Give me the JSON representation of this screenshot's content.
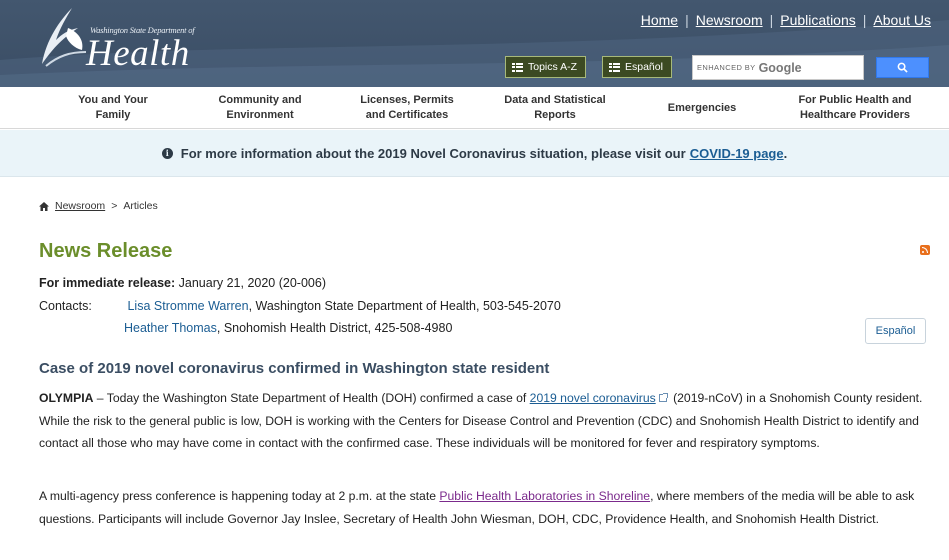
{
  "logo": {
    "department": "Washington State Department of",
    "word": "Health"
  },
  "toplinks": [
    "Home",
    "Newsroom",
    "Publications",
    "About Us"
  ],
  "buttons": {
    "topics": "Topics A-Z",
    "espanol": "Español"
  },
  "search": {
    "enhanced_by": "ENHANCED BY",
    "google": "Google"
  },
  "nav": [
    {
      "line1": "You and Your",
      "line2": "Family"
    },
    {
      "line1": "Community and",
      "line2": "Environment"
    },
    {
      "line1": "Licenses, Permits",
      "line2": "and Certificates"
    },
    {
      "line1": "Data and Statistical",
      "line2": "Reports"
    },
    {
      "line1": "Emergencies",
      "line2": ""
    },
    {
      "line1": "For Public Health and",
      "line2": "Healthcare Providers"
    }
  ],
  "alert": {
    "text": "For more information about the 2019 Novel Coronavirus situation, please visit our",
    "link": "COVID-19 page",
    "end": "."
  },
  "breadcrumb": {
    "link": "Newsroom",
    "sep": ">",
    "current": "Articles"
  },
  "release": {
    "title": "News Release",
    "label": "For immediate release:",
    "date": "January 21, 2020  (20-006)",
    "contacts_label": "Contacts:",
    "contact1_name": "Lisa Stromme Warren",
    "contact1_rest": ", Washington State Department of Health,  503-545-2070",
    "contact2_name": "Heather Thomas",
    "contact2_rest": ", Snohomish Health District,  425-508-4980",
    "espanol": "Español"
  },
  "article": {
    "headline": "Case of 2019 novel coronavirus confirmed in Washington state resident",
    "p1_lead": "OLYMPIA",
    "p1_a": " – Today the Washington State Department of Health (DOH) confirmed a case of ",
    "p1_link": "2019 novel coronavirus",
    "p1_b": " (2019-nCoV) in a Snohomish County resident. While the risk to the general public is low, DOH is working with the Centers for Disease Control and Prevention (CDC) and Snohomish Health District to identify and contact all those who may have come in contact with the confirmed case. These individuals will be monitored for fever and respiratory symptoms.",
    "p2_a": "A multi-agency press conference is happening today at 2 p.m. at the state ",
    "p2_link": "Public Health Laboratories in Shoreline",
    "p2_b": ", where members of the media will be able to ask questions. Participants will include Governor Jay Inslee, Secretary of Health John Wiesman, DOH, CDC, Providence Health, and Snohomish Health District."
  },
  "colors": {
    "header": "#43576f",
    "title_green": "#6b8e2b",
    "link_blue": "#1b5d93",
    "visited_purple": "#7b2a8c",
    "alert_bg": "#eaf4f9"
  }
}
